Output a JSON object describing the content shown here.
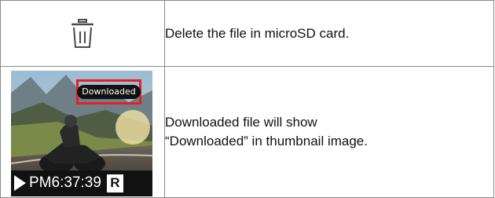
{
  "rows": [
    {
      "icon": "trash-icon",
      "description": "Delete the file in microSD card."
    },
    {
      "description_lines": [
        "Downloaded file will show",
        "“Downloaded” in thumbnail image."
      ]
    }
  ],
  "thumbnail": {
    "badge": "Downloaded",
    "time": "PM6:37:39",
    "tag": "R",
    "play_icon": "play-icon",
    "badge_highlight_color": "#e41e2b"
  }
}
